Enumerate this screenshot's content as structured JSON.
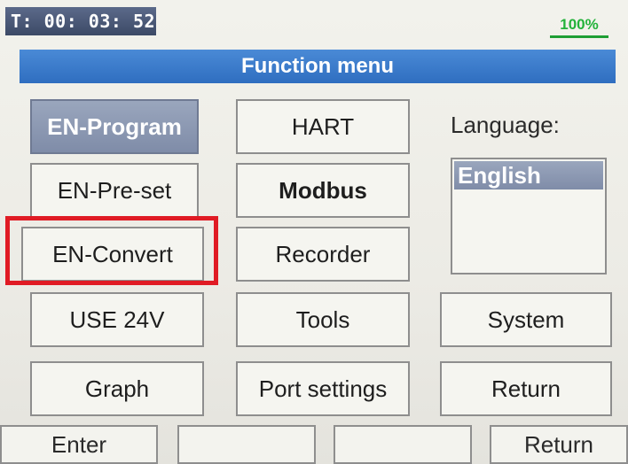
{
  "status": {
    "timer": "T: 00: 03: 52",
    "battery": "100%"
  },
  "title": "Function menu",
  "menu": {
    "col1": [
      "EN-Program",
      "EN-Pre-set",
      "EN-Convert",
      "USE 24V",
      "Graph"
    ],
    "col2": [
      "HART",
      "Modbus",
      "Recorder",
      "Tools",
      "Port settings"
    ],
    "col3": [
      "System",
      "Return"
    ]
  },
  "language": {
    "label": "Language:",
    "options": [
      "English"
    ],
    "selected": "English"
  },
  "softkeys": [
    "Enter",
    "",
    "",
    "Return"
  ],
  "colors": {
    "title_bar": "#2f6ec0",
    "selected": "#8b97b1",
    "highlight": "#e01b24",
    "battery": "#23b23a"
  }
}
